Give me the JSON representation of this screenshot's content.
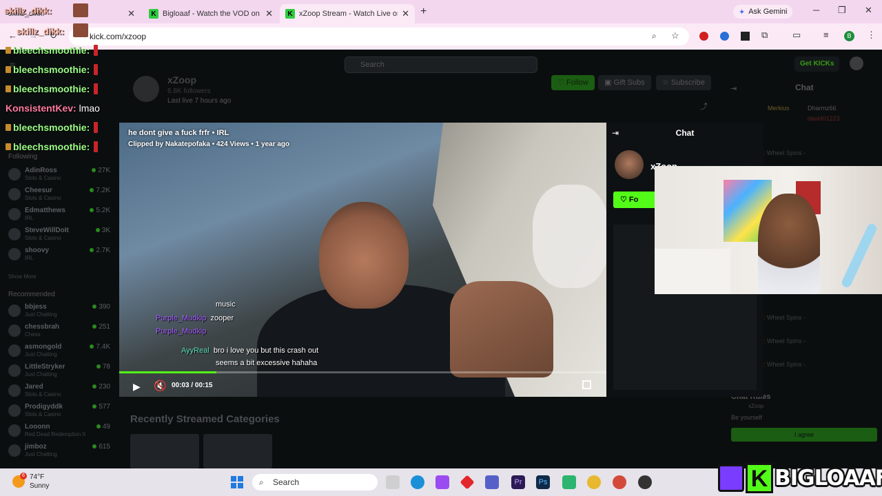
{
  "browser": {
    "tabs": [
      {
        "title": "skillz_dikk:",
        "active": false
      },
      {
        "title": "Bigloaaf - Watch the VOD on K",
        "active": false
      },
      {
        "title": "xZoop Stream - Watch Live on K",
        "active": true
      }
    ],
    "new_tab": "+",
    "gemini_label": "Ask Gemini",
    "url": "kick.com/xzoop",
    "window": {
      "minimize": "─",
      "maximize": "❐",
      "close": "✕"
    }
  },
  "kick": {
    "search_placeholder": "Search",
    "get_kicks": "Get KICKs",
    "channel": {
      "name": "xZoop",
      "followers": "6.8K followers",
      "last_live": "Last live 7 hours ago"
    },
    "actions": {
      "follow": "Follow",
      "gift_subs": "Gift Subs",
      "subscribe": "Subscribe"
    },
    "sidebar": {
      "following_label": "Following",
      "following": [
        {
          "name": "AdinRoss",
          "category": "Slots & Casino",
          "viewers": "27K"
        },
        {
          "name": "Cheesur",
          "category": "Slots & Casino",
          "viewers": "7.2K"
        },
        {
          "name": "Edmatthews",
          "category": "IRL",
          "viewers": "5.2K"
        },
        {
          "name": "SteveWillDoIt",
          "category": "Slots & Casino",
          "viewers": "3K"
        },
        {
          "name": "shoovy",
          "category": "IRL",
          "viewers": "2.7K"
        }
      ],
      "show_more": "Show More",
      "recommended_label": "Recommended",
      "recommended": [
        {
          "name": "bbjess",
          "category": "Just Chatting",
          "viewers": "390"
        },
        {
          "name": "chessbrah",
          "category": "Chess",
          "viewers": "251"
        },
        {
          "name": "asmongold",
          "category": "Just Chatting",
          "viewers": "7.4K"
        },
        {
          "name": "LittleStryker",
          "category": "Just Chatting",
          "viewers": "78"
        },
        {
          "name": "Jared",
          "category": "Slots & Casino",
          "viewers": "230"
        },
        {
          "name": "Prodigyddk",
          "category": "Slots & Casino",
          "viewers": "577"
        },
        {
          "name": "Looonn",
          "category": "Red Dead Redemption II",
          "viewers": "49"
        },
        {
          "name": "jimboz",
          "category": "Just Chatting",
          "viewers": "615"
        }
      ]
    },
    "recent_categories_title": "Recently Streamed Categories",
    "right_chat": {
      "title": "Chat",
      "top_users": [
        "Merkius",
        "Dharmz66",
        "david01223"
      ],
      "lines": [
        "Wheel Spins -",
        "Wheel Spins -",
        "Wheel Spins -",
        "Wheel Spins -"
      ],
      "rules_title": "Chat Rules",
      "rules_user": "xZoop",
      "rules_text": "Be yourself",
      "agree": "I agree"
    }
  },
  "player": {
    "clip_title": "he dont give a fuck frfr • IRL",
    "clip_meta": "Clipped by Nakatepofaka • 424 Views • 1 year ago",
    "chat": [
      {
        "user": "",
        "text": "music"
      },
      {
        "user": "Purple_Mudkip",
        "text": "zooper"
      },
      {
        "user": "Purple_Mudkip",
        "text": ""
      },
      {
        "user": "AyyReal",
        "text": "bro i love you but this crash out"
      },
      {
        "user": "",
        "text": "seems a bit excessive hahaha"
      }
    ],
    "time": "00:03 / 00:15",
    "progress_fraction": 0.2
  },
  "modal_chat": {
    "title": "Chat",
    "streamer": "xZoop",
    "follow": "Fo"
  },
  "overlay_chat": {
    "top_user": "skillz_dikk:",
    "lines": [
      {
        "user": "bleechsmoothie:",
        "msg": ""
      },
      {
        "user": "bleechsmoothie:",
        "msg": ""
      },
      {
        "user": "bleechsmoothie:",
        "msg": ""
      },
      {
        "user": "KonsistentKev:",
        "msg": "lmao"
      },
      {
        "user": "bleechsmoothie:",
        "msg": ""
      },
      {
        "user": "bleechsmoothie:",
        "msg": ""
      }
    ]
  },
  "taskbar": {
    "weather_temp": "74°F",
    "weather_desc": "Sunny",
    "weather_badge": "6",
    "search_label": "Search"
  },
  "branding": {
    "name": "BIGLOAAF",
    "k": "K"
  }
}
